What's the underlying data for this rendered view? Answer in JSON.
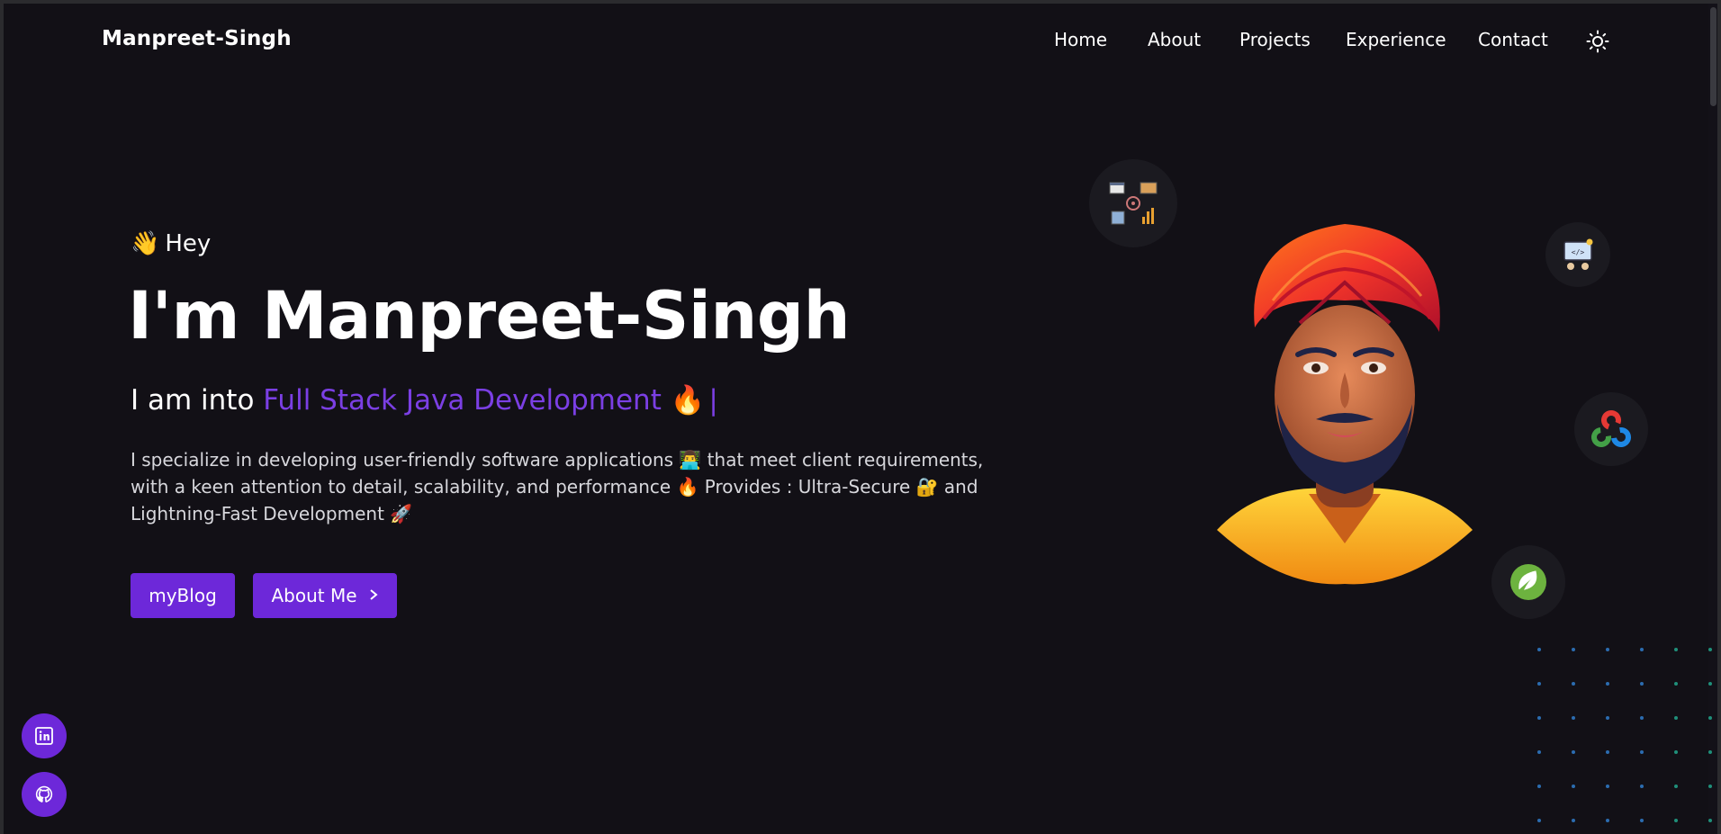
{
  "brand": "Manpreet-Singh",
  "nav": {
    "items": [
      {
        "label": "Home"
      },
      {
        "label": "About"
      },
      {
        "label": "Projects"
      },
      {
        "label": "Experience"
      },
      {
        "label": "Contact"
      }
    ],
    "theme_icon": "sun-icon"
  },
  "hero": {
    "greeting_emoji": "👋",
    "greeting": "Hey",
    "title": "I'm Manpreet-Singh",
    "subtitle_prefix": "I am into",
    "subtitle_accent": "Full Stack Java Development",
    "subtitle_emoji": "🔥",
    "subtitle_cursor": "|",
    "description": "I specialize in developing user-friendly software applications 👨‍💻 that meet client requirements, with a keen attention to detail, scalability, and performance 🔥 Provides : Ultra-Secure 🔐 and Lightning-Fast Development 🚀",
    "buttons": {
      "blog": "myBlog",
      "about": "About Me",
      "about_icon": "chevron-right-icon"
    }
  },
  "floating_icons": [
    "system-components-icon",
    "developer-coding-icon",
    "opencv-icon",
    "spring-leaf-icon"
  ],
  "social": [
    {
      "name": "linkedin-icon"
    },
    {
      "name": "github-icon"
    }
  ],
  "colors": {
    "background": "#121016",
    "accent": "#6d28d9",
    "accent_text": "#7b3fe4",
    "text": "#ffffff"
  }
}
